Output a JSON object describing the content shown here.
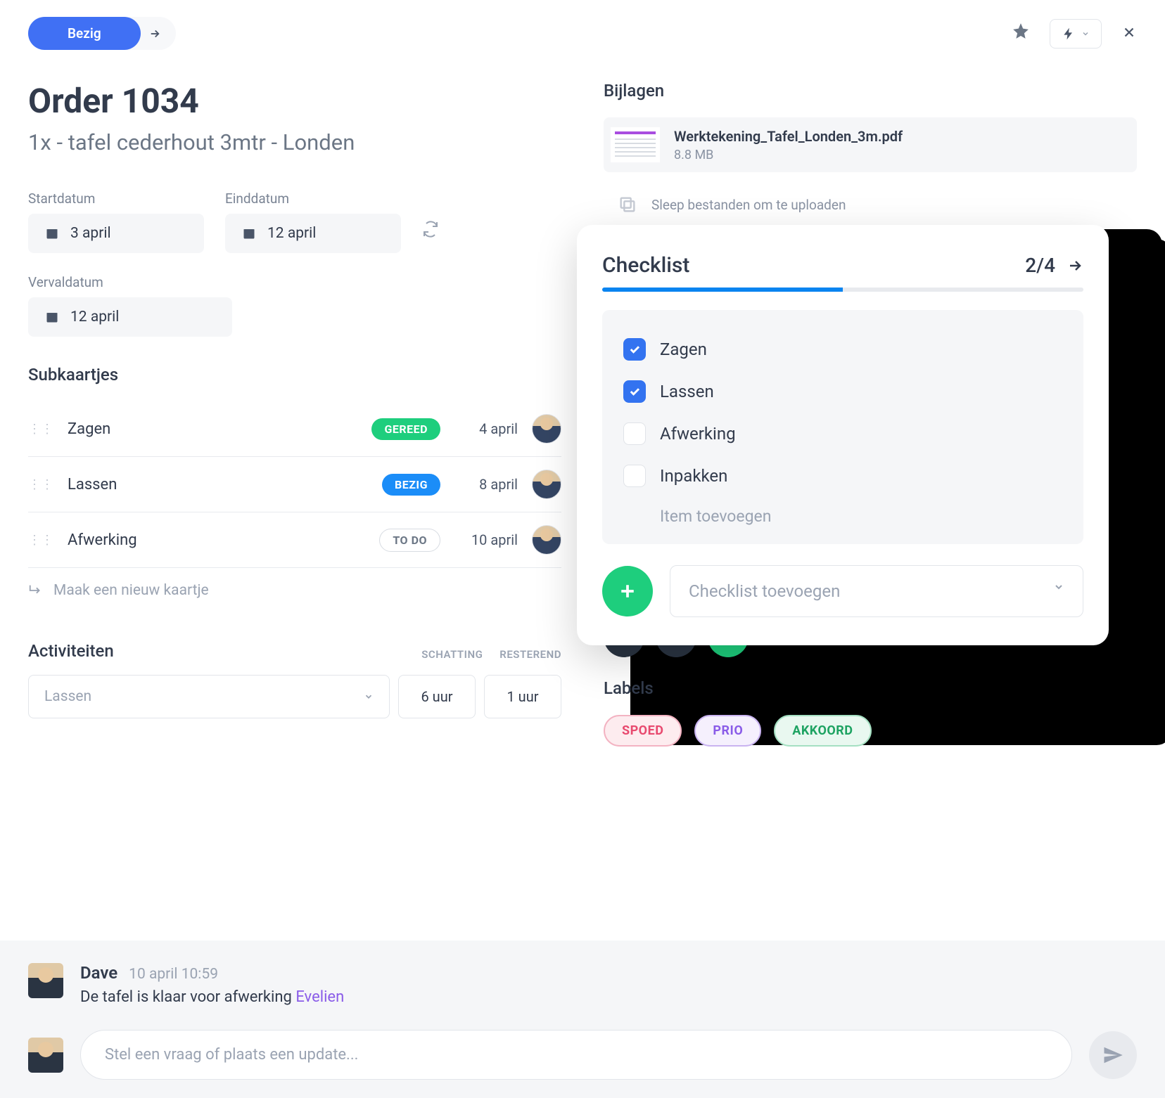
{
  "status": {
    "label": "Bezig"
  },
  "order": {
    "title": "Order 1034",
    "subtitle": "1x - tafel cederhout 3mtr - Londen"
  },
  "dates": {
    "start": {
      "label": "Startdatum",
      "value": "3 april"
    },
    "end": {
      "label": "Einddatum",
      "value": "12 april"
    },
    "due": {
      "label": "Vervaldatum",
      "value": "12 april"
    }
  },
  "subcards": {
    "title": "Subkaartjes",
    "items": [
      {
        "name": "Zagen",
        "status": "GEREED",
        "date": "4 april"
      },
      {
        "name": "Lassen",
        "status": "BEZIG",
        "date": "8 april"
      },
      {
        "name": "Afwerking",
        "status": "TO DO",
        "date": "10 april"
      }
    ],
    "new_label": "Maak een nieuw kaartje"
  },
  "activities": {
    "title": "Activiteiten",
    "col_est": "SCHATTING",
    "col_rem": "RESTEREND",
    "placeholder": "Lassen",
    "est": "6 uur",
    "rem": "1 uur"
  },
  "attachments": {
    "title": "Bijlagen",
    "file": {
      "name": "Werktekening_Tafel_Londen_3m.pdf",
      "size": "8.8 MB"
    },
    "upload_hint": "Sleep bestanden om te uploaden"
  },
  "labels_section": {
    "title": "Labels",
    "items": [
      "SPOED",
      "PRIO",
      "AKKOORD"
    ]
  },
  "checklist": {
    "title": "Checklist",
    "count": "2/4",
    "progress_pct": 50,
    "items": [
      {
        "label": "Zagen",
        "checked": true
      },
      {
        "label": "Lassen",
        "checked": true
      },
      {
        "label": "Afwerking",
        "checked": false
      },
      {
        "label": "Inpakken",
        "checked": false
      }
    ],
    "add_item": "Item toevoegen",
    "add_checklist": "Checklist toevoegen"
  },
  "comment": {
    "author": "Dave",
    "time": "10 april 10:59",
    "text": "De tafel is klaar voor afwerking ",
    "mention": "Evelien"
  },
  "compose": {
    "placeholder": "Stel een vraag of plaats een update..."
  }
}
